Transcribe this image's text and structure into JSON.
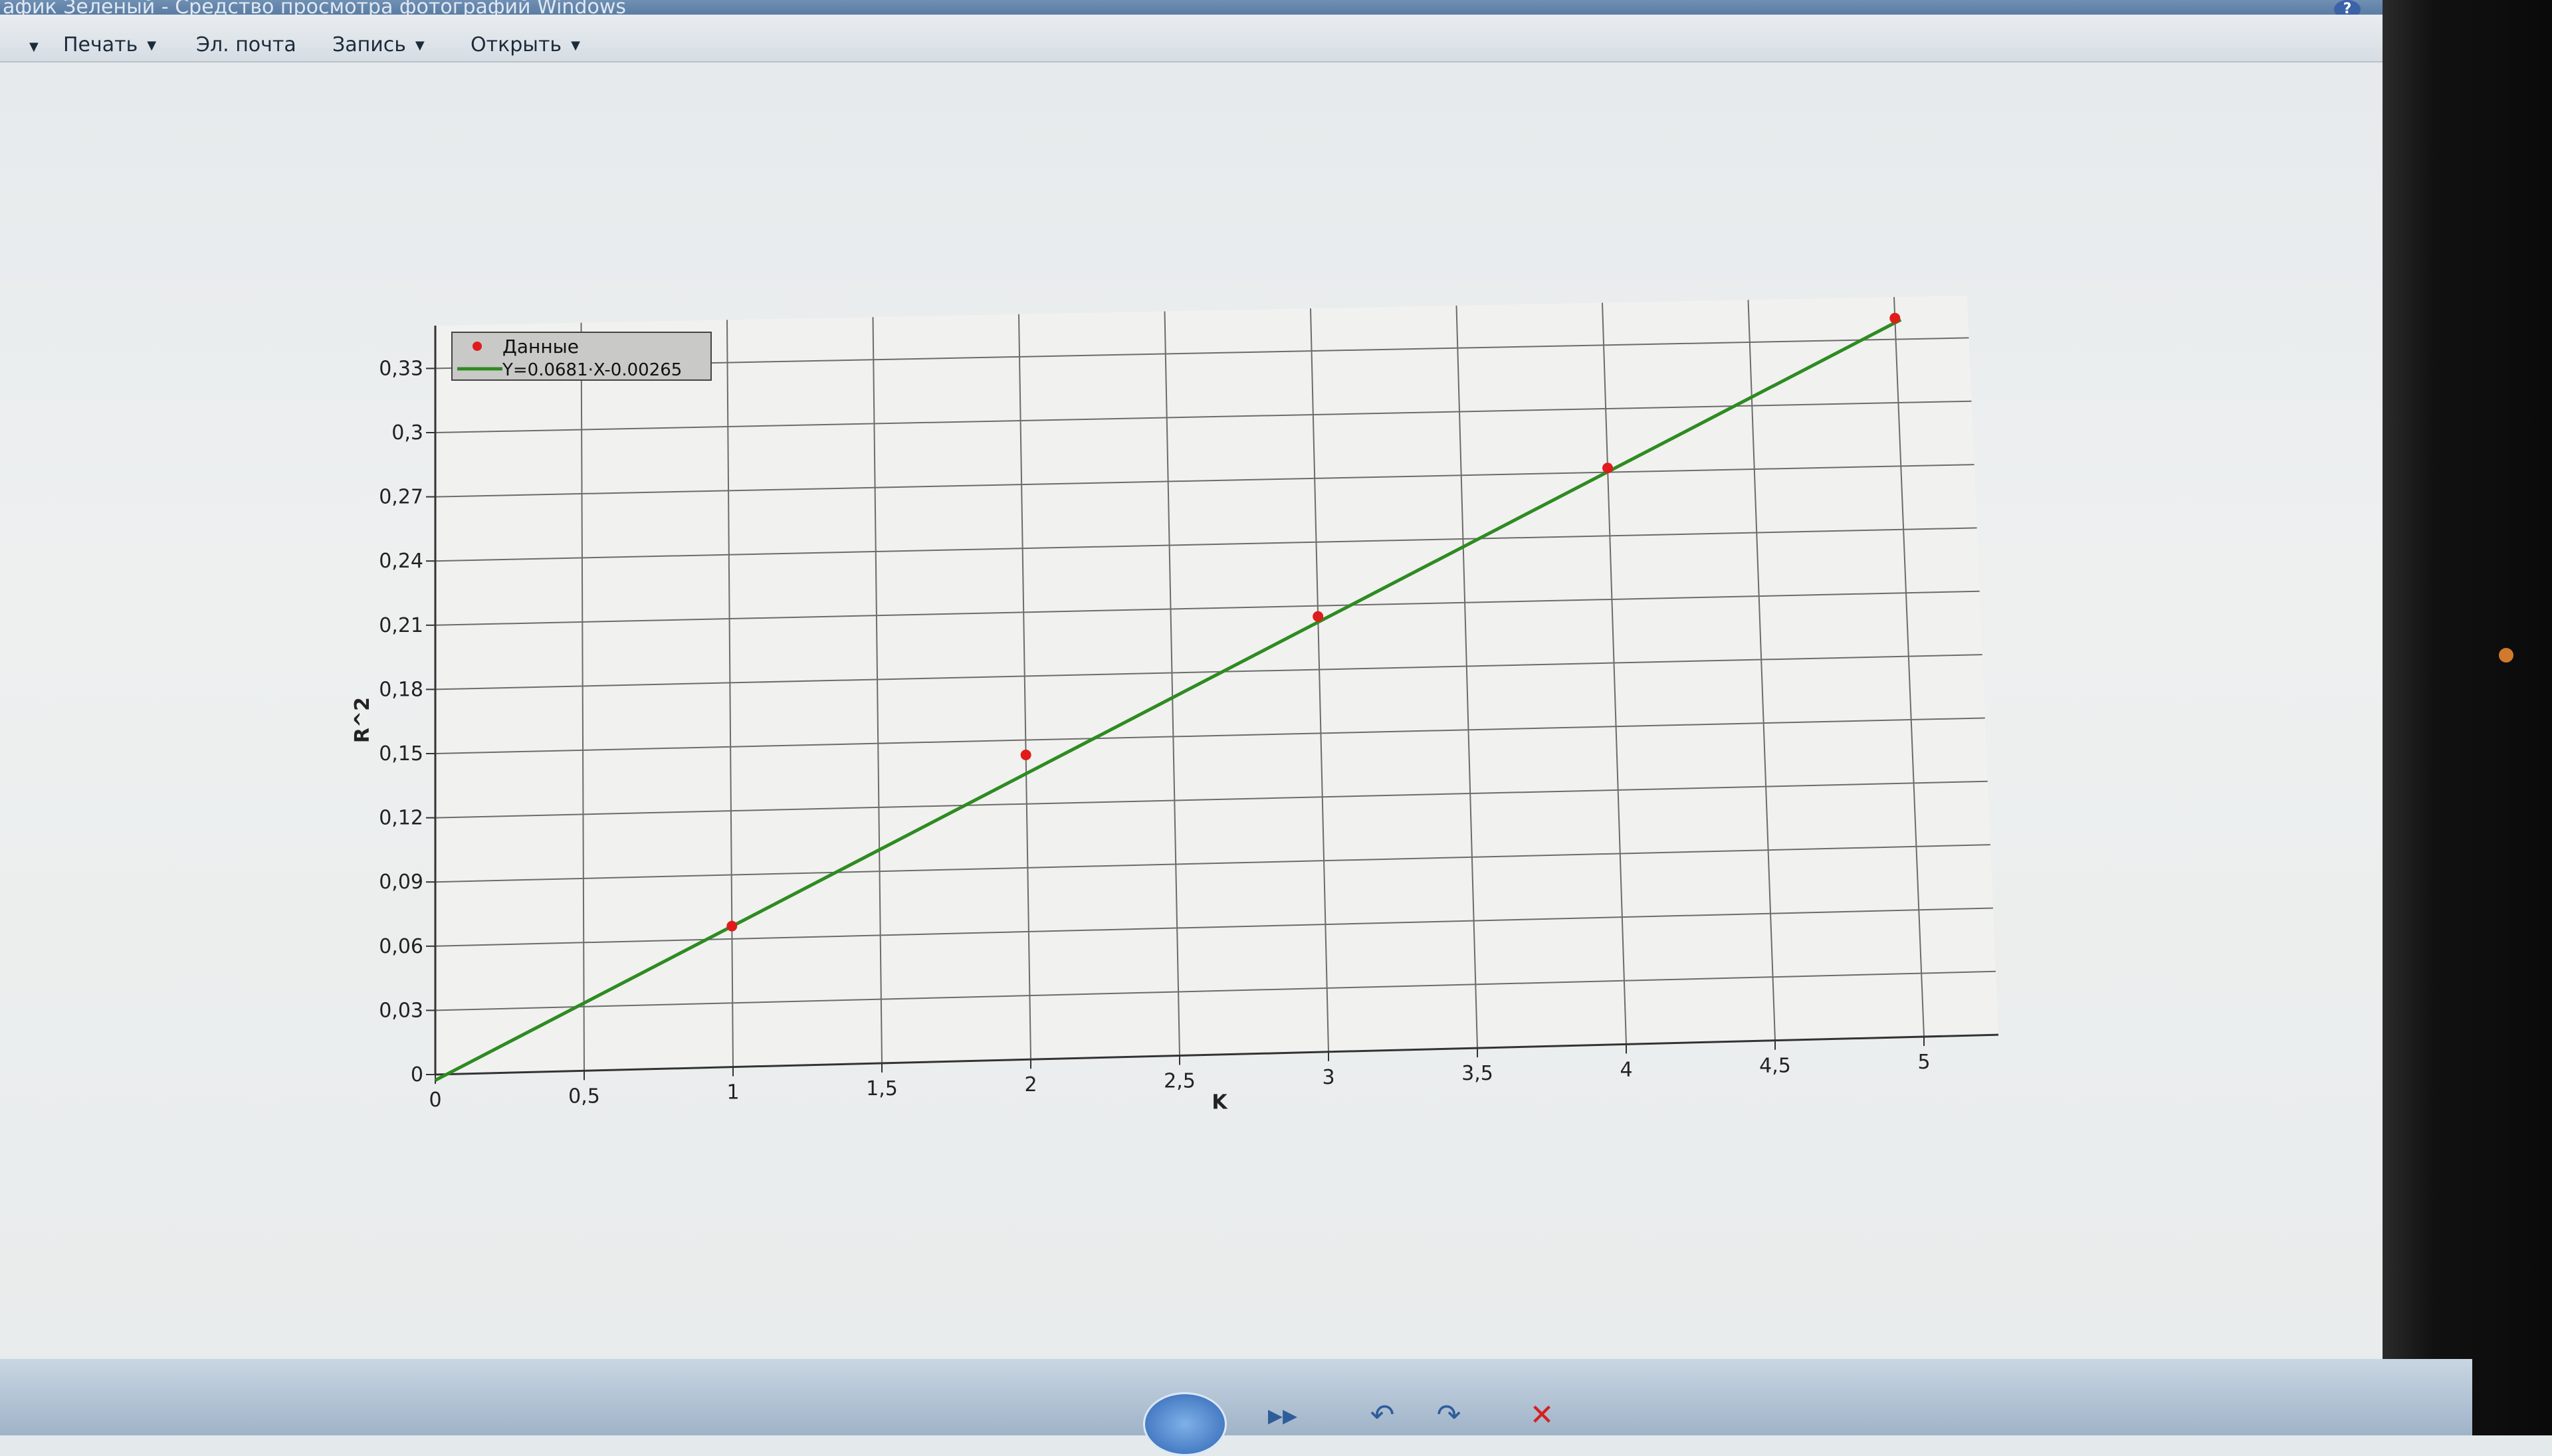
{
  "window": {
    "title": "афик Зеленый - Средство просмотра фотографий Windows"
  },
  "menu": {
    "items": [
      {
        "label": "Печать",
        "has_arrow": true
      },
      {
        "label": "Эл. почта",
        "has_arrow": false
      },
      {
        "label": "Запись",
        "has_arrow": true
      },
      {
        "label": "Открыть",
        "has_arrow": true
      }
    ]
  },
  "controls": {
    "icons": [
      "slideshow-icon",
      "previous-icon",
      "next-icon",
      "rotate-left-icon",
      "rotate-right-icon",
      "delete-icon"
    ]
  },
  "chart_data": {
    "type": "scatter",
    "title": "",
    "xlabel": "K",
    "ylabel": "R^2",
    "xlim": [
      0,
      5
    ],
    "ylim": [
      0,
      0.35
    ],
    "x_ticks": [
      "0",
      "0,5",
      "1",
      "1,5",
      "2",
      "2,5",
      "3",
      "3,5",
      "4",
      "4,5",
      "5"
    ],
    "y_ticks": [
      "0",
      "0,03",
      "0,06",
      "0,09",
      "0,12",
      "0,15",
      "0,18",
      "0,21",
      "0,24",
      "0,27",
      "0,3",
      "0,33"
    ],
    "grid": true,
    "legend_position": "top-left",
    "series": [
      {
        "name": "Данные",
        "kind": "points",
        "color": "#e01b1b",
        "x": [
          1,
          2,
          3,
          4,
          5
        ],
        "y": [
          0.066,
          0.143,
          0.205,
          0.272,
          0.34
        ]
      },
      {
        "name": "Y=0.0681·X-0.00265",
        "kind": "fit-line",
        "color": "#2e8b22",
        "slope": 0.0681,
        "intercept": -0.00265,
        "x": [
          0,
          5.02
        ]
      }
    ]
  }
}
